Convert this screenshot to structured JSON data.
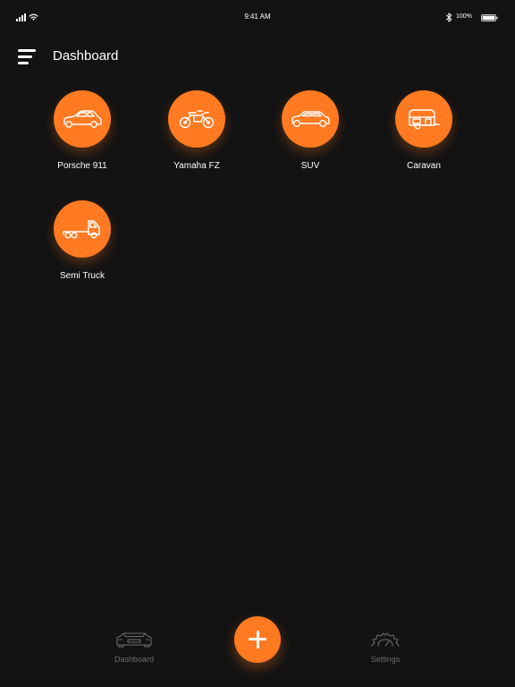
{
  "status_bar": {
    "time": "9:41 AM",
    "battery_percent": "100%",
    "signal_icon": "signal-icon",
    "wifi_icon": "wifi-icon",
    "bluetooth_icon": "bluetooth-icon",
    "battery_icon": "battery-icon"
  },
  "header": {
    "title": "Dashboard",
    "menu_icon": "hamburger-menu-icon"
  },
  "vehicles": [
    {
      "label": "Porsche 911",
      "icon": "car-icon"
    },
    {
      "label": "Yamaha FZ",
      "icon": "motorcycle-icon"
    },
    {
      "label": "SUV",
      "icon": "suv-icon"
    },
    {
      "label": "Caravan",
      "icon": "caravan-icon"
    },
    {
      "label": "Semi Truck",
      "icon": "truck-icon"
    }
  ],
  "tab_bar": {
    "dashboard_label": "Dashboard",
    "settings_label": "Settings",
    "add_icon": "plus-icon",
    "dashboard_icon": "car-outline-icon",
    "settings_icon": "gauge-icon"
  },
  "colors": {
    "background": "#131313",
    "accent": "#ff7a21",
    "inactive_tab": "#6c6c6c"
  }
}
